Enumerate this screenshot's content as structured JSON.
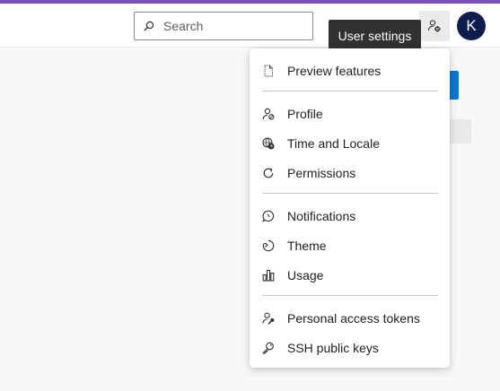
{
  "header": {
    "search": {
      "placeholder": "Search",
      "icon": "search-icon"
    },
    "settings_button": {
      "icon": "user-gear-icon"
    },
    "avatar": {
      "initial": "K",
      "color": "#0f1d4e"
    },
    "tooltip": "User settings"
  },
  "colors": {
    "accent_stripe": "#7b4fc0",
    "primary": "#0078d4",
    "tooltip_bg": "#323130"
  },
  "menu": {
    "groups": [
      {
        "items": [
          {
            "label": "Preview features",
            "icon": "document-icon"
          }
        ]
      },
      {
        "items": [
          {
            "label": "Profile",
            "icon": "profile-icon"
          },
          {
            "label": "Time and Locale",
            "icon": "globe-clock-icon"
          },
          {
            "label": "Permissions",
            "icon": "refresh-icon"
          }
        ]
      },
      {
        "items": [
          {
            "label": "Notifications",
            "icon": "chat-bubble-icon"
          },
          {
            "label": "Theme",
            "icon": "palette-icon"
          },
          {
            "label": "Usage",
            "icon": "bar-chart-icon"
          }
        ]
      },
      {
        "items": [
          {
            "label": "Personal access tokens",
            "icon": "person-key-icon"
          },
          {
            "label": "SSH public keys",
            "icon": "key-icon"
          }
        ]
      }
    ]
  }
}
